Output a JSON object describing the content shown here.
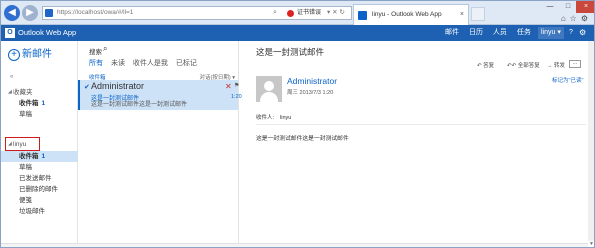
{
  "browser": {
    "url": "https://localhost/owa/#/ll=1",
    "cert_error": "证书错误",
    "tab_title": "linyu - Outlook Web App",
    "tab_close": "×",
    "new_tab": "",
    "min": "—",
    "max": "□",
    "close": "×",
    "icons": "⌂☆⚙"
  },
  "header": {
    "app_title": "Outlook Web App",
    "nav": [
      "邮件",
      "日历",
      "人员",
      "任务"
    ],
    "user": "linyu ▾",
    "help": "?",
    "settings": "⚙"
  },
  "left": {
    "new_mail": "新邮件",
    "favorites": "收藏夹",
    "fav_items": [
      {
        "label": "收件箱",
        "count": "1"
      },
      {
        "label": "草稿",
        "count": ""
      }
    ],
    "account": "linyu",
    "account_items": [
      {
        "label": "收件箱",
        "count": "1"
      },
      {
        "label": "草稿",
        "count": ""
      },
      {
        "label": "已发送邮件",
        "count": ""
      },
      {
        "label": "已删除的邮件",
        "count": ""
      },
      {
        "label": "便笺",
        "count": ""
      },
      {
        "label": "垃圾邮件",
        "count": ""
      }
    ]
  },
  "list": {
    "search_label": "搜索",
    "filters": [
      "所有",
      "未读",
      "收件人是我",
      "已标记"
    ],
    "header_left": "收件箱",
    "header_right": "对话(按日期) ▾",
    "messages": [
      {
        "sender": "Administrator",
        "subject": "这是一封测试邮件",
        "preview": "这是一封测试邮件这是一封测试邮件",
        "time": "1:20"
      }
    ]
  },
  "reading": {
    "subject": "这是一封测试邮件",
    "reply": "↶ 答复",
    "reply_all": "↶↶ 全部答复",
    "forward": "→ 转发",
    "more": "···",
    "mark_unread": "标记为\"已读\"",
    "sender": "Administrator",
    "date": "周三 2013/7/3 1:20",
    "to_label": "收件人:",
    "to_value": "linyu",
    "body": "这是一封测试邮件这是一封测试邮件"
  },
  "colors": {
    "accent": "#1e61b3",
    "link": "#0a63c9",
    "selected": "#cde2f7",
    "highlight_box": "#d21a1a"
  }
}
